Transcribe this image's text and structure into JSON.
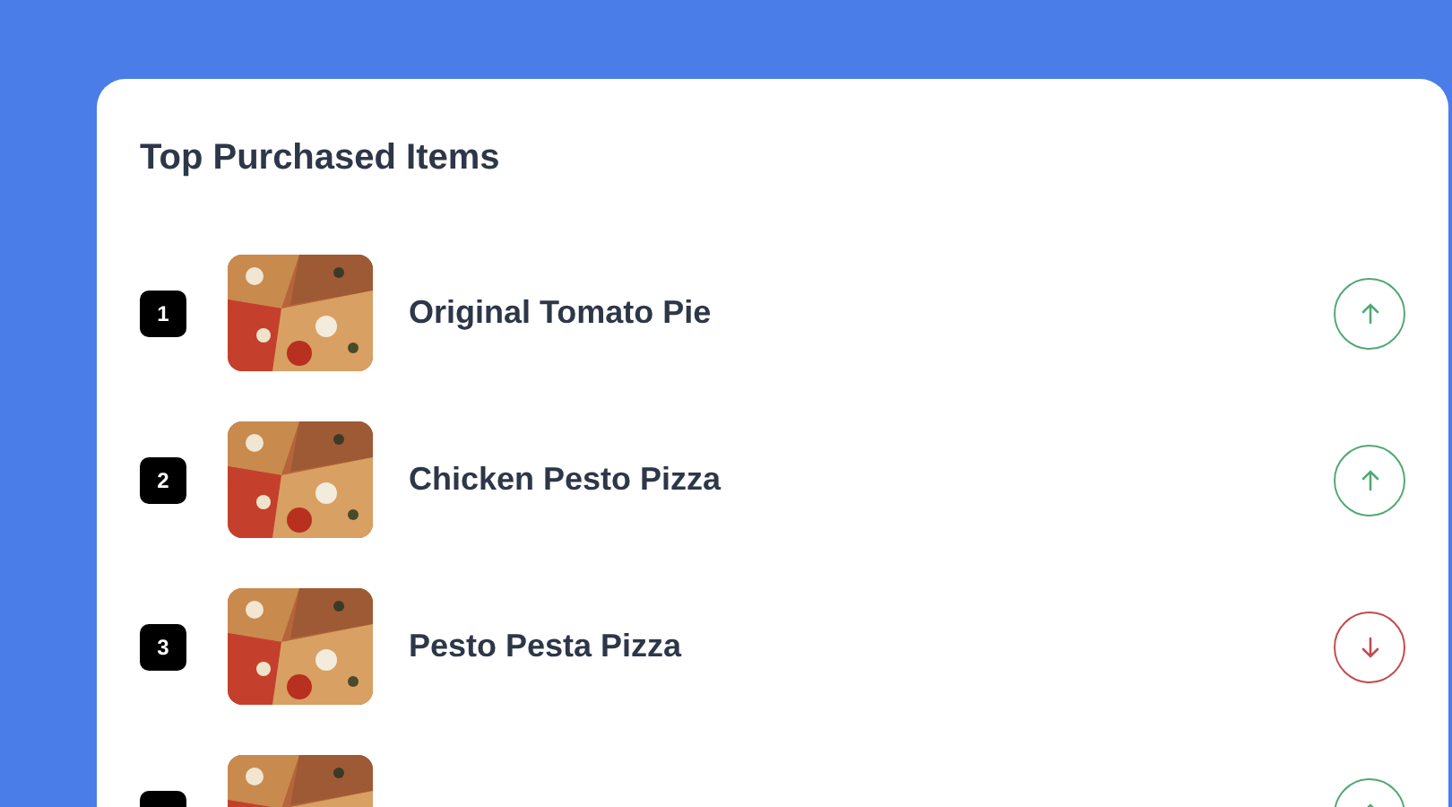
{
  "card": {
    "title": "Top Purchased Items"
  },
  "items": [
    {
      "rank": "1",
      "name": "Original Tomato Pie",
      "rising": true
    },
    {
      "rank": "2",
      "name": "Chicken Pesto Pizza",
      "rising": true
    },
    {
      "rank": "3",
      "name": "Pesto Pesta Pizza",
      "rising": false
    },
    {
      "rising": true
    }
  ]
}
